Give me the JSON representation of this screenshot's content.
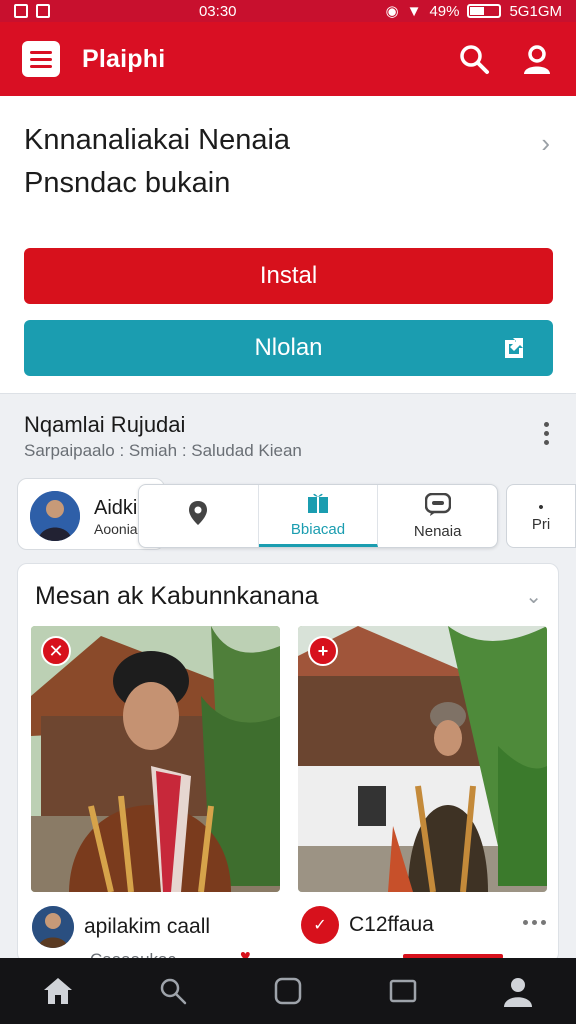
{
  "statusbar": {
    "time": "03:30",
    "battery": "49%",
    "network": "5G1GM",
    "battery_level": 0.49
  },
  "appbar": {
    "title": "Plaiphi"
  },
  "header": {
    "title": "Knnanaliakai Nenaia",
    "subtitle": "Pnsndac bukain",
    "install_label": "Instal",
    "nlolan_label": "Nlolan"
  },
  "section": {
    "title": "Nqamlai Rujudai",
    "subtitle": "Sarpaipaalo : Smiah : Saludad Kiean"
  },
  "chips": {
    "profile_name": "Aidki",
    "profile_sub": "Aooniaiuacas",
    "tabs": [
      {
        "label": ""
      },
      {
        "label": "Bbiacad"
      },
      {
        "label": "Nenaia"
      }
    ],
    "extra_label": "Pri"
  },
  "feed": {
    "title": "Mesan ak Kabunnkanana",
    "post1": {
      "author": "apilakim caall",
      "sub": "Caaaaukac"
    },
    "post2": {
      "author": "C12ffaua"
    }
  },
  "colors": {
    "brand_red": "#d90f23",
    "teal": "#1b9db0"
  },
  "icons": [
    "menu-icon",
    "search-icon",
    "profile-icon",
    "share-icon",
    "location-pin-icon",
    "gift-icon",
    "chat-icon",
    "home-icon",
    "square-icon",
    "tablet-icon",
    "user-icon"
  ]
}
